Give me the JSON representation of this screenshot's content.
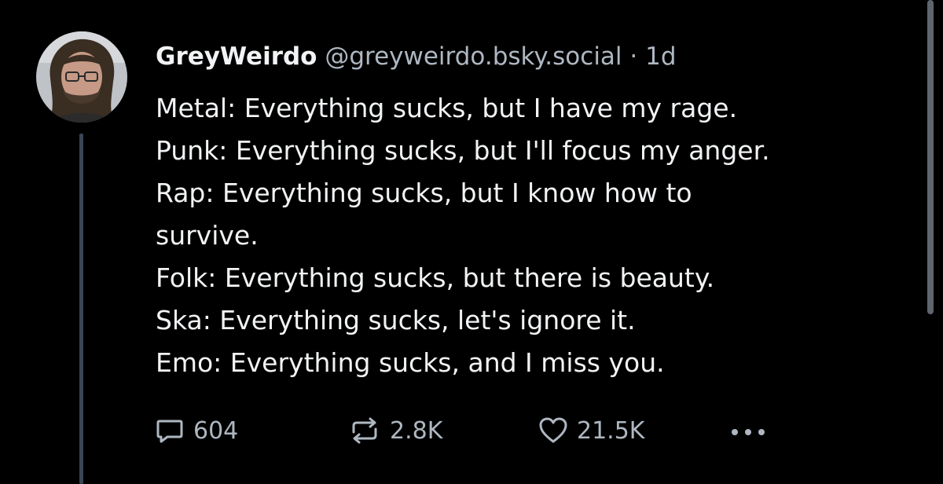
{
  "author": {
    "display_name": "GreyWeirdo",
    "handle": "@greyweirdo.bsky.social",
    "separator": "·",
    "time_ago": "1d"
  },
  "post": {
    "lines": [
      "Metal: Everything sucks, but I have my rage.",
      "Punk: Everything sucks, but I'll focus my anger.",
      "Rap: Everything sucks, but I know how to",
      "survive.",
      "Folk: Everything sucks, but there is beauty.",
      "Ska: Everything sucks, let's ignore it.",
      "Emo: Everything sucks, and I miss you."
    ]
  },
  "actions": {
    "replies": {
      "icon": "comment-icon",
      "count": "604"
    },
    "reposts": {
      "icon": "repost-icon",
      "count": "2.8K"
    },
    "likes": {
      "icon": "heart-icon",
      "count": "21.5K"
    },
    "more": {
      "icon": "more-dots-icon"
    }
  },
  "colors": {
    "background": "#000000",
    "primary_text": "#f1f3f5",
    "secondary_text": "#aeb7c1",
    "thread_line": "#3a4654"
  }
}
